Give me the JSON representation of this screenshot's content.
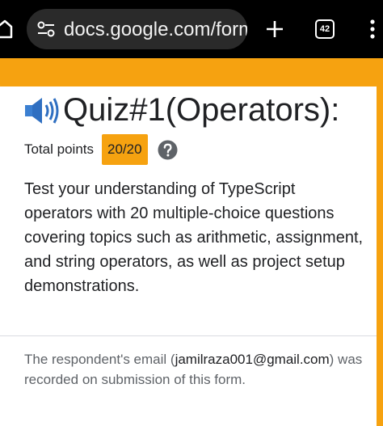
{
  "browser": {
    "url": "docs.google.com/form",
    "tab_count": "42",
    "icons": [
      "home-icon",
      "tune-icon",
      "plus-icon",
      "tabs-icon",
      "more-vert-icon"
    ]
  },
  "form": {
    "title": "Quiz#1(Operators):",
    "title_icon": "speaker-icon",
    "points_label": "Total points",
    "points_value": "20/20",
    "help_icon": "help-icon",
    "description": "Test your understanding of TypeScript operators with 20 multiple-choice questions covering topics such as arithmetic, assignment, and string operators, as well as project setup demonstrations.",
    "email_note_prefix": "The respondent's email (",
    "email": "jamilraza001@gmail.com",
    "email_note_suffix": ") was recorded on submission of this form.",
    "accent_color": "#f6a210"
  }
}
